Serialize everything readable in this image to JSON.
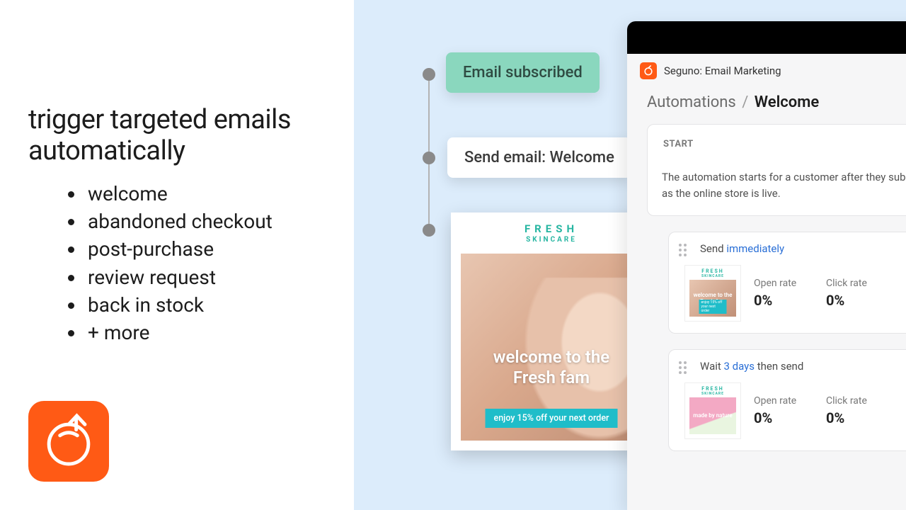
{
  "left": {
    "headline": "trigger targeted emails automatically",
    "bullets": [
      "welcome",
      "abandoned checkout",
      "post-purchase",
      "review request",
      "back in stock",
      "+ more"
    ]
  },
  "timeline": {
    "nodes": [
      {
        "kind": "trigger",
        "label": "Email subscribed"
      },
      {
        "kind": "action",
        "label": "Send email: Welcome"
      },
      {
        "kind": "preview"
      }
    ]
  },
  "preview": {
    "brand_top": "FRESH",
    "brand_sub": "SKINCARE",
    "hero_line1": "welcome to the",
    "hero_line2": "Fresh fam",
    "hero_pill": "enjoy 15% off your next order"
  },
  "app": {
    "name": "Seguno: Email Marketing",
    "crumb_root": "Automations",
    "crumb_leaf": "Welcome",
    "start_label": "START",
    "start_body": "The automation starts for a customer after they subscribe, as long as the online store is live.",
    "steps": [
      {
        "prefix": "Send ",
        "link": "immediately",
        "suffix": "",
        "thumb_copy": "welcome to the Fresh fam",
        "thumb_pill": "enjoy 15% off your next order",
        "metrics": [
          {
            "label": "Open rate",
            "value": "0%"
          },
          {
            "label": "Click rate",
            "value": "0%"
          }
        ]
      },
      {
        "prefix": "Wait ",
        "link": "3 days",
        "suffix": " then send",
        "thumb_copy": "made by nature",
        "metrics": [
          {
            "label": "Open rate",
            "value": "0%"
          },
          {
            "label": "Click rate",
            "value": "0%"
          }
        ]
      }
    ]
  }
}
